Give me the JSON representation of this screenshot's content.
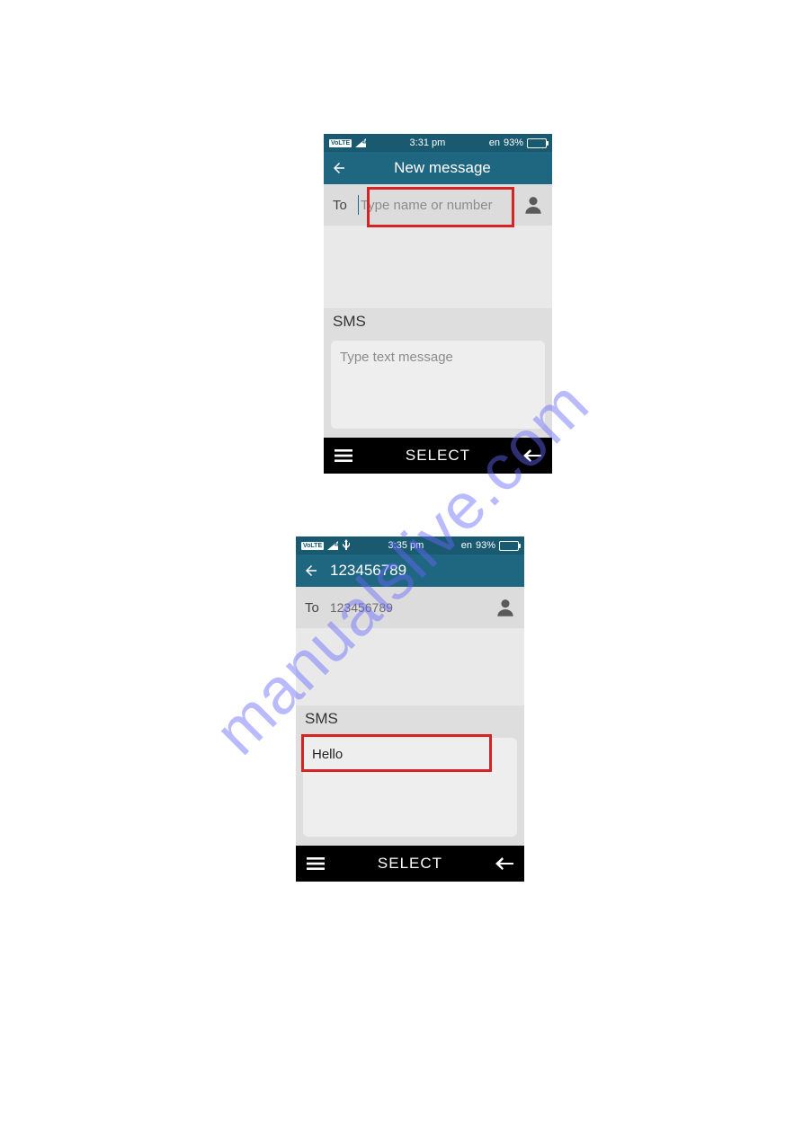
{
  "watermark": "manualslive.com",
  "phone1": {
    "status": {
      "volte": "VoLTE",
      "time": "3:31 pm",
      "lang": "en",
      "battery_pct": "93%"
    },
    "title": "New message",
    "to_label": "To",
    "to_placeholder": "Type name or number",
    "sms_label": "SMS",
    "msg_placeholder": "Type text message",
    "softkey_center": "SELECT"
  },
  "phone2": {
    "status": {
      "volte": "VoLTE",
      "time": "3:35 pm",
      "lang": "en",
      "battery_pct": "93%"
    },
    "title": "123456789",
    "to_label": "To",
    "to_value": "123456789",
    "sms_label": "SMS",
    "msg_value": "Hello",
    "softkey_center": "SELECT"
  }
}
